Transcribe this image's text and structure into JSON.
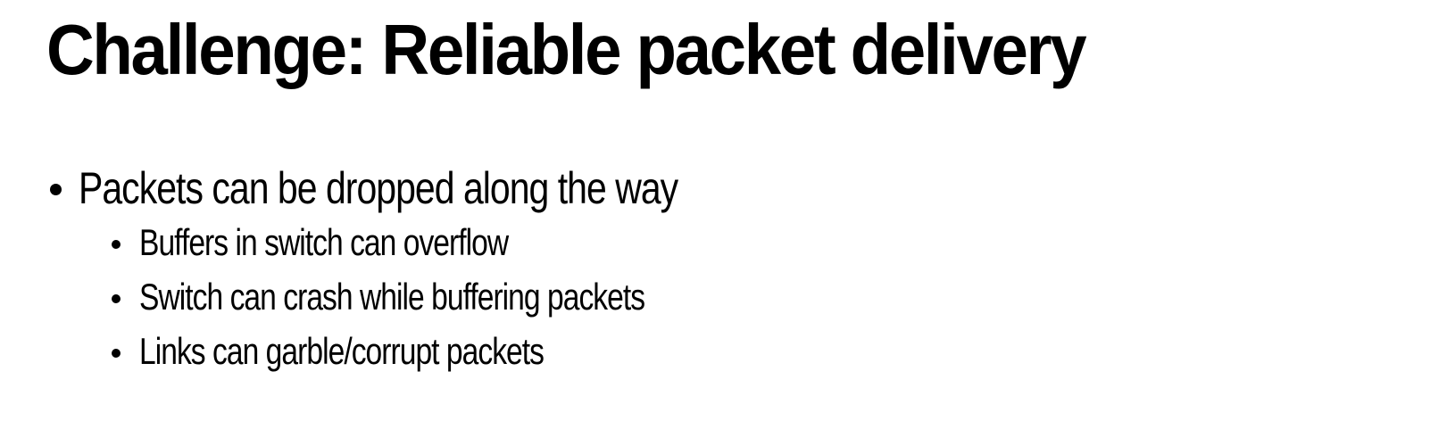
{
  "slide": {
    "title": "Challenge: Reliable packet delivery",
    "bullets": [
      {
        "text": "Packets can be dropped along the way",
        "subbullets": [
          "Buffers in switch can overflow",
          "Switch can crash while buffering packets",
          "Links can garble/corrupt packets"
        ]
      }
    ]
  }
}
